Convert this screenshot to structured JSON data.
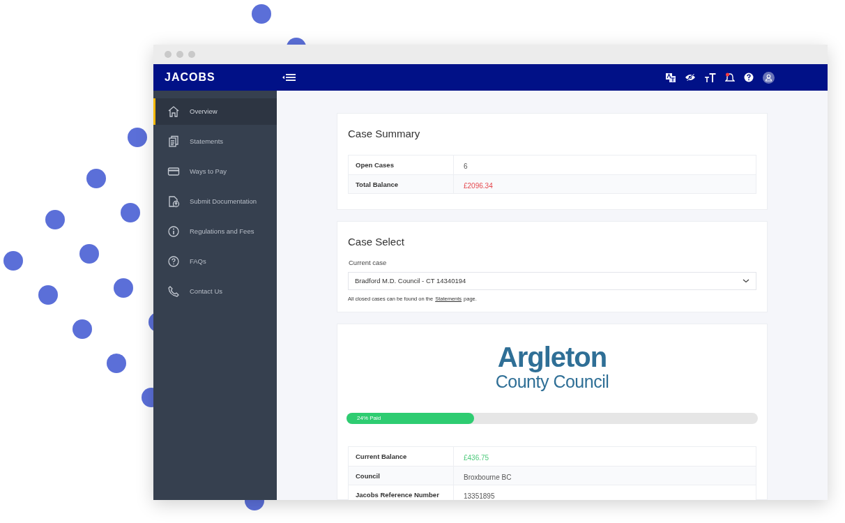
{
  "header": {
    "logo": "JACOBS"
  },
  "sidebar": {
    "items": [
      {
        "label": "Overview",
        "selected": true
      },
      {
        "label": "Statements",
        "selected": false
      },
      {
        "label": "Ways to Pay",
        "selected": false
      },
      {
        "label": "Submit Documentation",
        "selected": false
      },
      {
        "label": "Regulations and Fees",
        "selected": false
      },
      {
        "label": "FAQs",
        "selected": false
      },
      {
        "label": "Contact Us",
        "selected": false
      }
    ]
  },
  "case_summary": {
    "title": "Case Summary",
    "rows": [
      {
        "label": "Open Cases",
        "value": "6"
      },
      {
        "label": "Total Balance",
        "value": "£2096.34",
        "color": "#e5484d"
      }
    ]
  },
  "case_select": {
    "title": "Case Select",
    "field_label": "Current case",
    "value": "Bradford M.D. Council - CT 14340194",
    "note_before": "All closed cases can be found on the",
    "note_link": "Statements",
    "note_after": "page."
  },
  "case_detail": {
    "logo_title": "Argleton",
    "logo_subtitle": "County Council",
    "progress": {
      "label": "24% Paid",
      "level": 0.31
    },
    "rows": [
      {
        "label": "Current Balance",
        "value": "£436.75",
        "color": "#4cc97a"
      },
      {
        "label": "Council",
        "value": "Broxbourne BC"
      },
      {
        "label": "Jacobs Reference Number",
        "value": "13351895"
      }
    ]
  }
}
